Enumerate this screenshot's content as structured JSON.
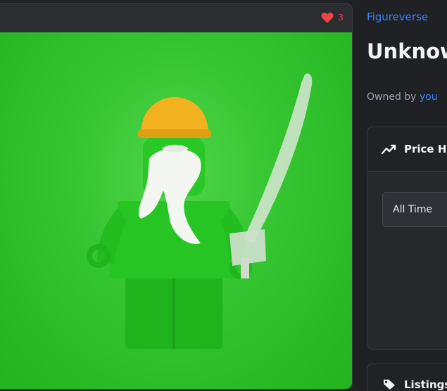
{
  "image_card": {
    "like_count": "3"
  },
  "item": {
    "collection": "Figureverse",
    "title": "Unknown",
    "owned_by_label": "Owned by",
    "owner": "you"
  },
  "price_history": {
    "title": "Price History",
    "period": "All Time"
  },
  "listings": {
    "title": "Listings"
  },
  "colors": {
    "accent": "#3b82f6",
    "like": "#ef4444",
    "background": "#202125",
    "card": "#2b2d31"
  },
  "icons": [
    "heart-icon",
    "trend-line-icon",
    "tag-icon"
  ]
}
